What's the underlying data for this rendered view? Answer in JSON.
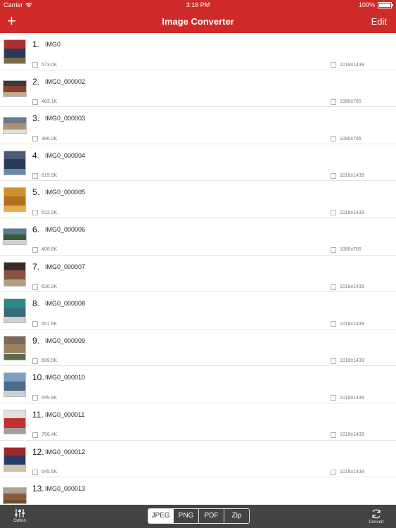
{
  "status": {
    "carrier": "Carrier",
    "time": "3:16 PM",
    "battery": "100%"
  },
  "nav": {
    "add_icon": "plus-icon",
    "title": "Image Converter",
    "edit_label": "Edit"
  },
  "rows": [
    {
      "num": "1.",
      "name": "IMG0",
      "size": "573.0K",
      "dims": "1018x1439",
      "thumb": "portrait",
      "c": [
        "#b03030",
        "#2a3a5a",
        "#7a6a4a"
      ]
    },
    {
      "num": "2.",
      "name": "IMG0_000002",
      "size": "463.1K",
      "dims": "1080x765",
      "thumb": "landscape",
      "c": [
        "#3a3a3a",
        "#8a4030",
        "#c0b090"
      ]
    },
    {
      "num": "3.",
      "name": "IMG0_000003",
      "size": "386.0K",
      "dims": "1080x765",
      "thumb": "landscape",
      "c": [
        "#6a7a8a",
        "#b09070",
        "#e0e0e0"
      ]
    },
    {
      "num": "4.",
      "name": "IMG0_000004",
      "size": "619.9K",
      "dims": "1018x1439",
      "thumb": "portrait",
      "c": [
        "#4a5a7a",
        "#2a3a5a",
        "#6a8aaa"
      ]
    },
    {
      "num": "5.",
      "name": "IMG0_000005",
      "size": "622.2K",
      "dims": "1018x1439",
      "thumb": "portrait",
      "c": [
        "#d09030",
        "#b07020",
        "#e0b050"
      ]
    },
    {
      "num": "6.",
      "name": "IMG0_000006",
      "size": "408.6K",
      "dims": "1080x765",
      "thumb": "landscape",
      "c": [
        "#5a7a9a",
        "#3a5a3a",
        "#d0d0d0"
      ]
    },
    {
      "num": "7.",
      "name": "IMG0_000007",
      "size": "630.3K",
      "dims": "1018x1439",
      "thumb": "portrait",
      "c": [
        "#3a2a2a",
        "#8a5040",
        "#b0a080"
      ]
    },
    {
      "num": "8.",
      "name": "IMG0_000008",
      "size": "601.6K",
      "dims": "1018x1439",
      "thumb": "portrait",
      "c": [
        "#2a8a8a",
        "#3a6a7a",
        "#d0d0d0"
      ]
    },
    {
      "num": "9.",
      "name": "IMG0_000009",
      "size": "699.9K",
      "dims": "1018x1439",
      "thumb": "portrait",
      "c": [
        "#7a6a5a",
        "#9a8060",
        "#5a6a4a"
      ]
    },
    {
      "num": "10.",
      "name": "IMG0_000010",
      "size": "695.9K",
      "dims": "1018x1439",
      "thumb": "portrait",
      "c": [
        "#7aa0c0",
        "#4a6a8a",
        "#d0d0d0"
      ]
    },
    {
      "num": "11.",
      "name": "IMG0_000011",
      "size": "756.4K",
      "dims": "1018x1439",
      "thumb": "portrait",
      "c": [
        "#e0e0e0",
        "#c03030",
        "#a0a0a0"
      ]
    },
    {
      "num": "12.",
      "name": "IMG0_000012",
      "size": "645.5K",
      "dims": "1018x1439",
      "thumb": "portrait",
      "c": [
        "#a02a2a",
        "#2a3a6a",
        "#d0c0b0"
      ]
    },
    {
      "num": "13.",
      "name": "IMG0_000013",
      "size": "",
      "dims": "",
      "thumb": "landscape",
      "c": [
        "#b0a090",
        "#8a5a3a",
        "#6a5030"
      ]
    }
  ],
  "toolbar": {
    "option_label": "Option",
    "option_icon": "sliders-icon",
    "formats": [
      "JPEG",
      "PNG",
      "PDF",
      "Zip"
    ],
    "selected_format": "JPEG",
    "convert_label": "Convert",
    "convert_icon": "refresh-icon"
  },
  "colors": {
    "accent": "#cf2a2a",
    "toolbar": "#444444"
  }
}
